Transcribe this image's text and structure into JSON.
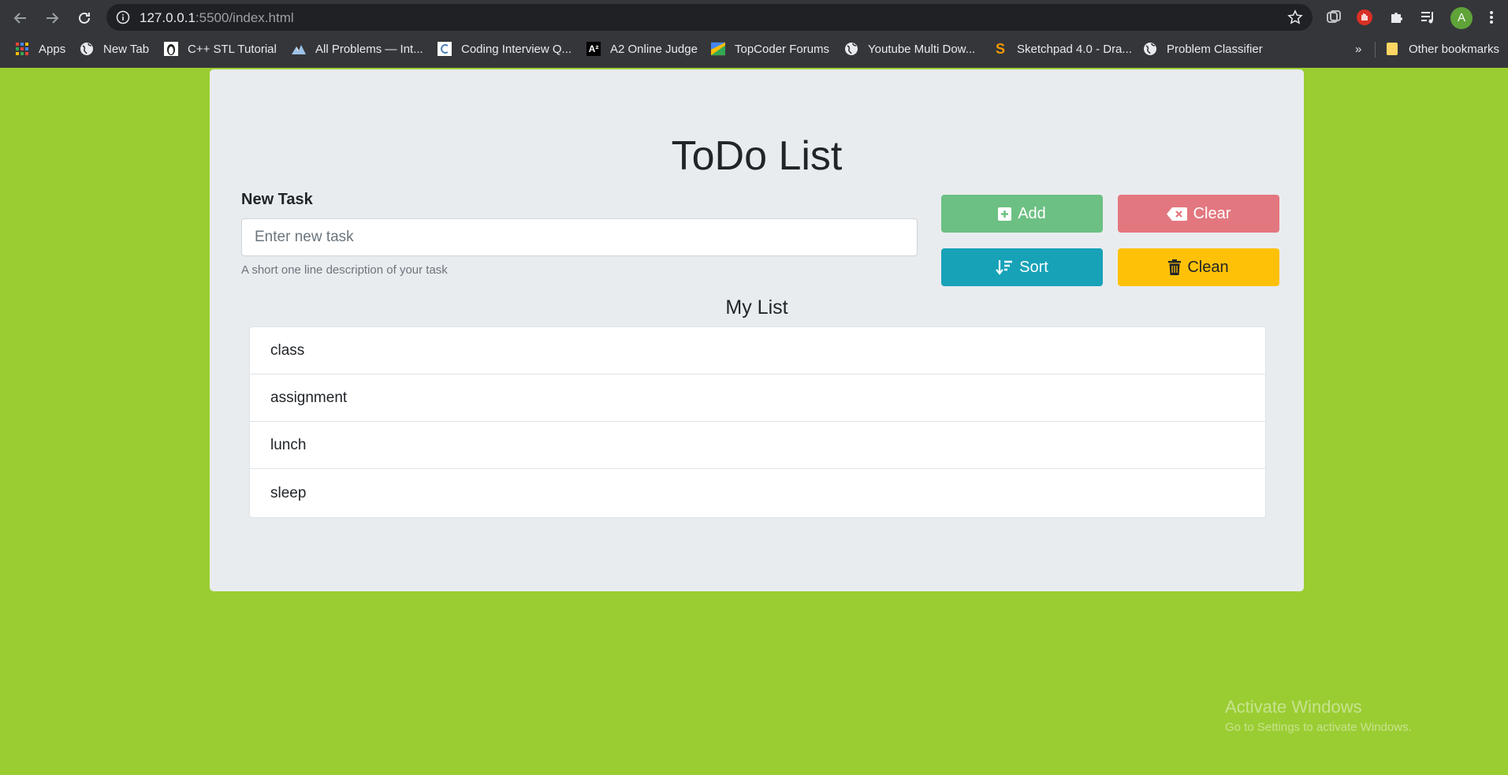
{
  "browser": {
    "url_host": "127.0.0.1",
    "url_rest": ":5500/index.html",
    "avatar_letter": "A",
    "bookmarks": [
      {
        "label": "Apps",
        "icon": "apps-grid-icon"
      },
      {
        "label": "New Tab",
        "icon": "globe-icon"
      },
      {
        "label": "C++ STL Tutorial",
        "icon": "penguin-icon"
      },
      {
        "label": "All Problems — Int...",
        "icon": "mountain-icon"
      },
      {
        "label": "Coding Interview Q...",
        "icon": "c-logo-icon"
      },
      {
        "label": "A2 Online Judge",
        "icon": "a2-logo-icon"
      },
      {
        "label": "TopCoder Forums",
        "icon": "topcoder-icon"
      },
      {
        "label": "Youtube Multi Dow...",
        "icon": "globe-icon"
      },
      {
        "label": "Sketchpad 4.0 - Dra...",
        "icon": "sketchpad-icon"
      },
      {
        "label": "Problem Classifier",
        "icon": "globe-icon"
      }
    ],
    "more_bookmarks": "»",
    "other_bookmarks": "Other bookmarks"
  },
  "page": {
    "title": "ToDo List",
    "new_task_label": "New Task",
    "input_placeholder": "Enter new task",
    "input_value": "",
    "help_text": "A short one line description of your task",
    "buttons": {
      "add": "Add",
      "clear": "Clear",
      "sort": "Sort",
      "clean": "Clean"
    },
    "list_title": "My List",
    "items": [
      "class",
      "assignment",
      "lunch",
      "sleep"
    ]
  },
  "colors": {
    "background": "#9acd32",
    "card": "#e9ecef",
    "add": "#6cc083",
    "clear": "#e3777f",
    "sort": "#17a2b8",
    "clean": "#ffc107"
  },
  "watermark": {
    "line1": "Activate Windows",
    "line2": "Go to Settings to activate Windows."
  }
}
